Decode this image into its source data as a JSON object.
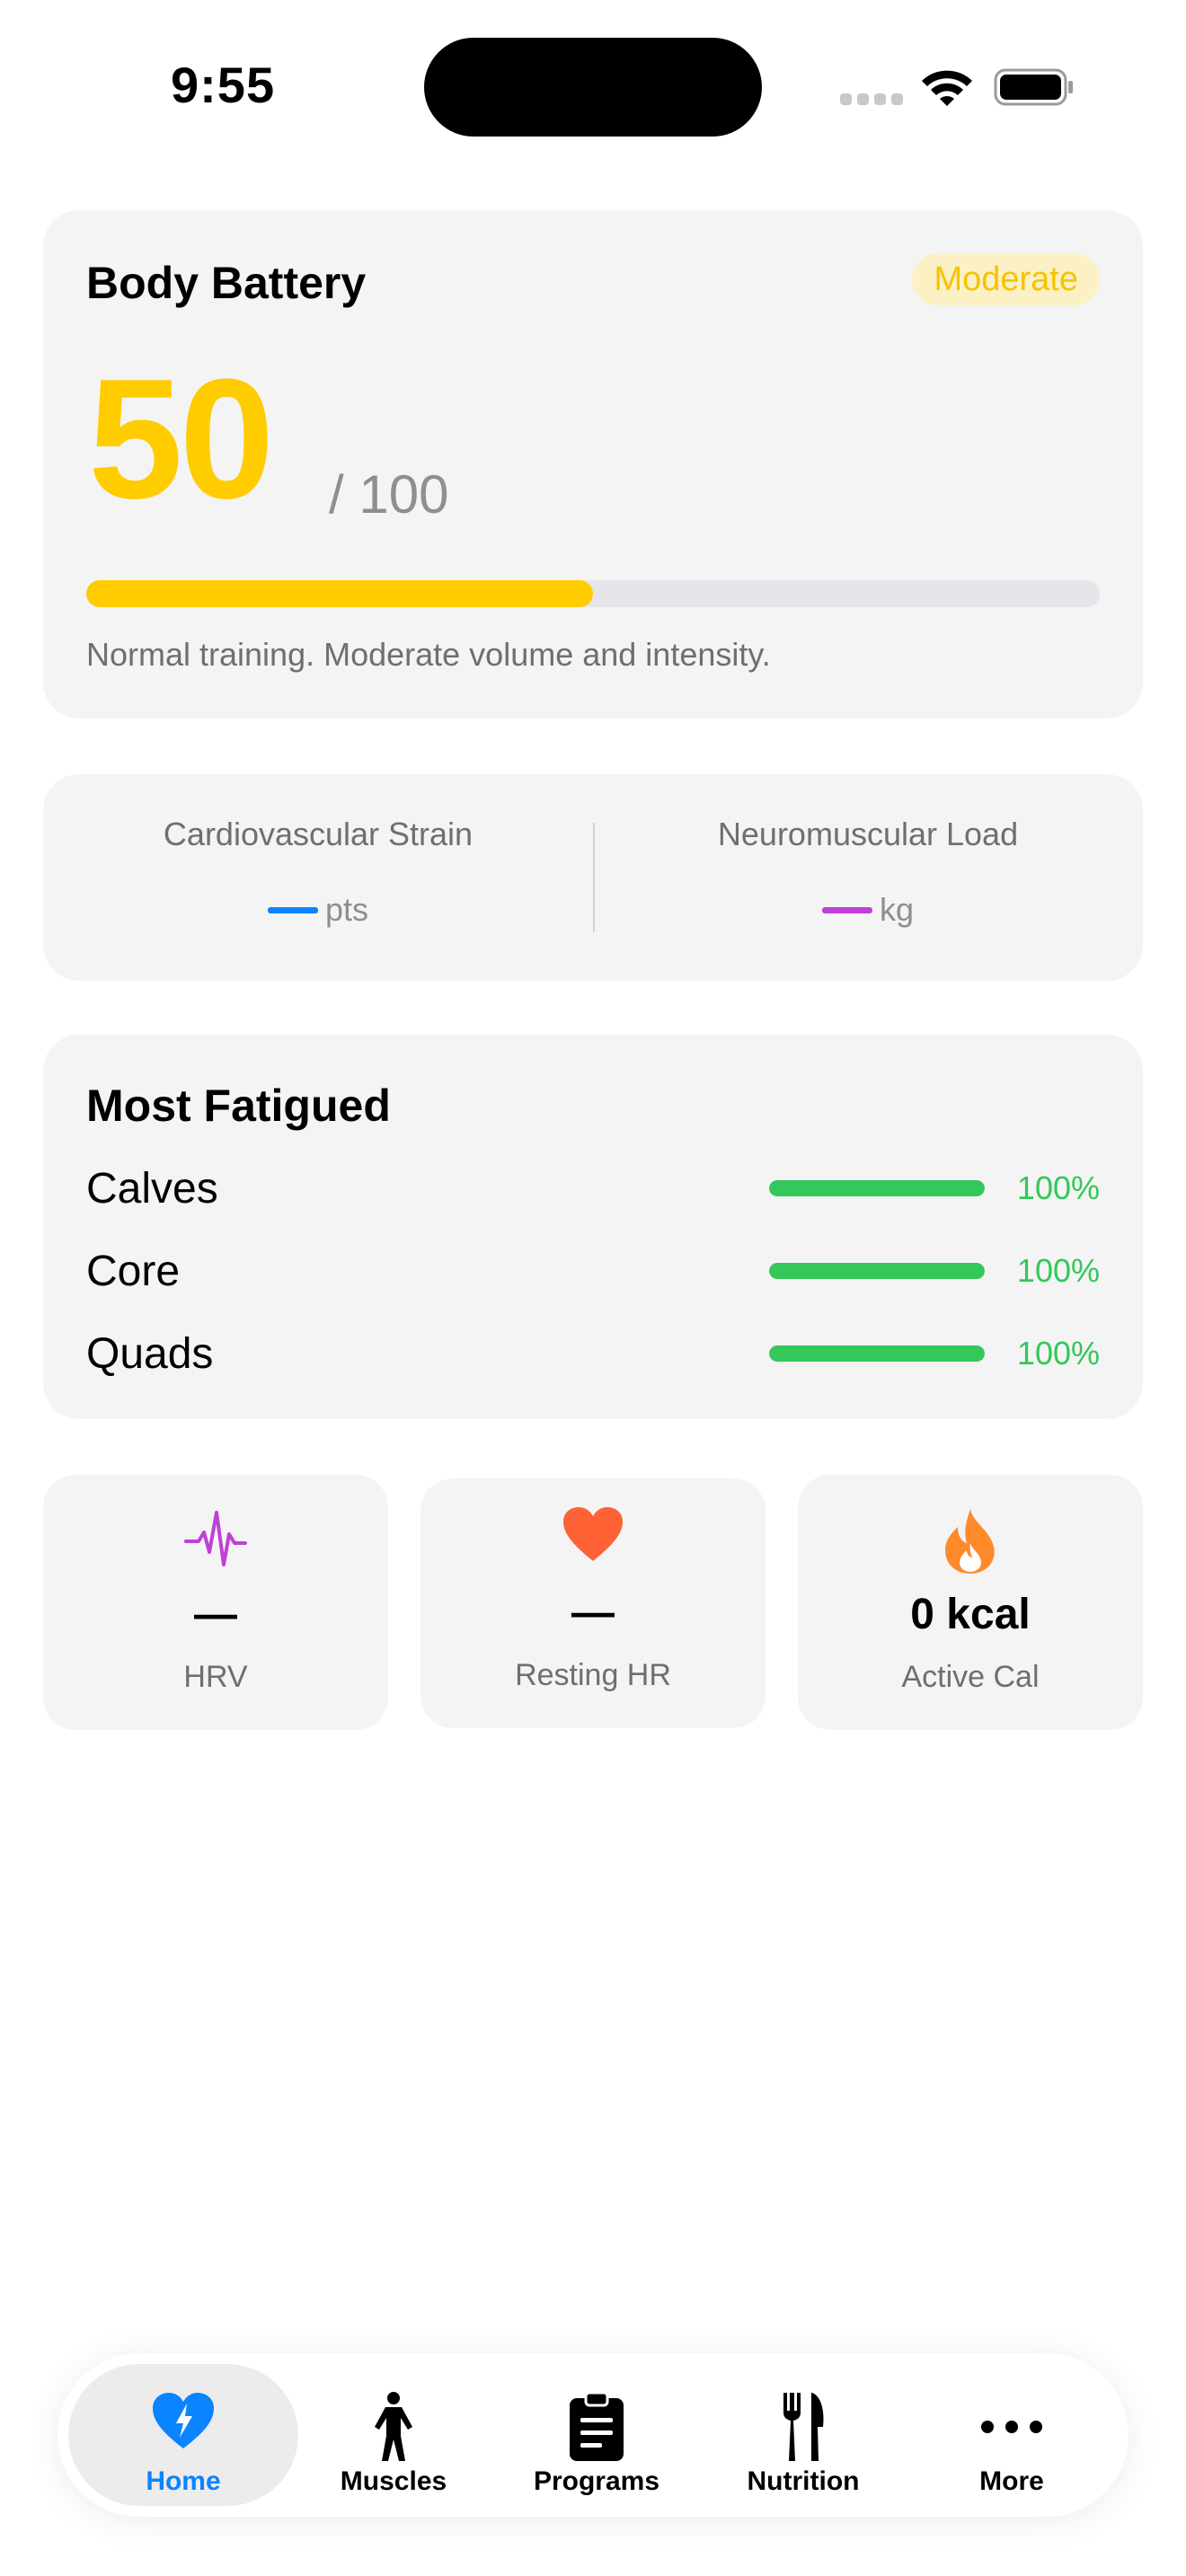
{
  "status_bar": {
    "time": "9:55"
  },
  "body_battery": {
    "title": "Body Battery",
    "badge": "Moderate",
    "score": "50",
    "max_label": "/ 100",
    "level_fraction": 0.5,
    "description": "Normal training. Moderate volume and intensity.",
    "accent_color": "#ffcc00"
  },
  "strain": {
    "cardio_label": "Cardiovascular Strain",
    "cardio_unit": "pts",
    "cardio_color": "#0a84ff",
    "neuro_label": "Neuromuscular Load",
    "neuro_unit": "kg",
    "neuro_color": "#bf40d8"
  },
  "fatigue": {
    "title": "Most Fatigued",
    "items": [
      {
        "name": "Calves",
        "percent": "100%",
        "level_fraction": 1.0
      },
      {
        "name": "Core",
        "percent": "100%",
        "level_fraction": 1.0
      },
      {
        "name": "Quads",
        "percent": "100%",
        "level_fraction": 1.0
      }
    ],
    "bar_color": "#34c759"
  },
  "metrics": [
    {
      "icon": "waveform-icon",
      "value": "—",
      "label": "HRV",
      "color": "#bf40d8"
    },
    {
      "icon": "heart-icon",
      "value": "—",
      "label": "Resting HR",
      "color": "#ff6235"
    },
    {
      "icon": "flame-icon",
      "value": "0 kcal",
      "label": "Active Cal",
      "color": "#ff8a2b"
    }
  ],
  "tab_bar": {
    "active": "Home",
    "tabs": [
      {
        "label": "Home",
        "icon": "heart-bolt-icon"
      },
      {
        "label": "Muscles",
        "icon": "figure-icon"
      },
      {
        "label": "Programs",
        "icon": "clipboard-icon"
      },
      {
        "label": "Nutrition",
        "icon": "fork-knife-icon"
      },
      {
        "label": "More",
        "icon": "ellipsis-icon"
      }
    ],
    "active_color": "#0a84ff"
  }
}
